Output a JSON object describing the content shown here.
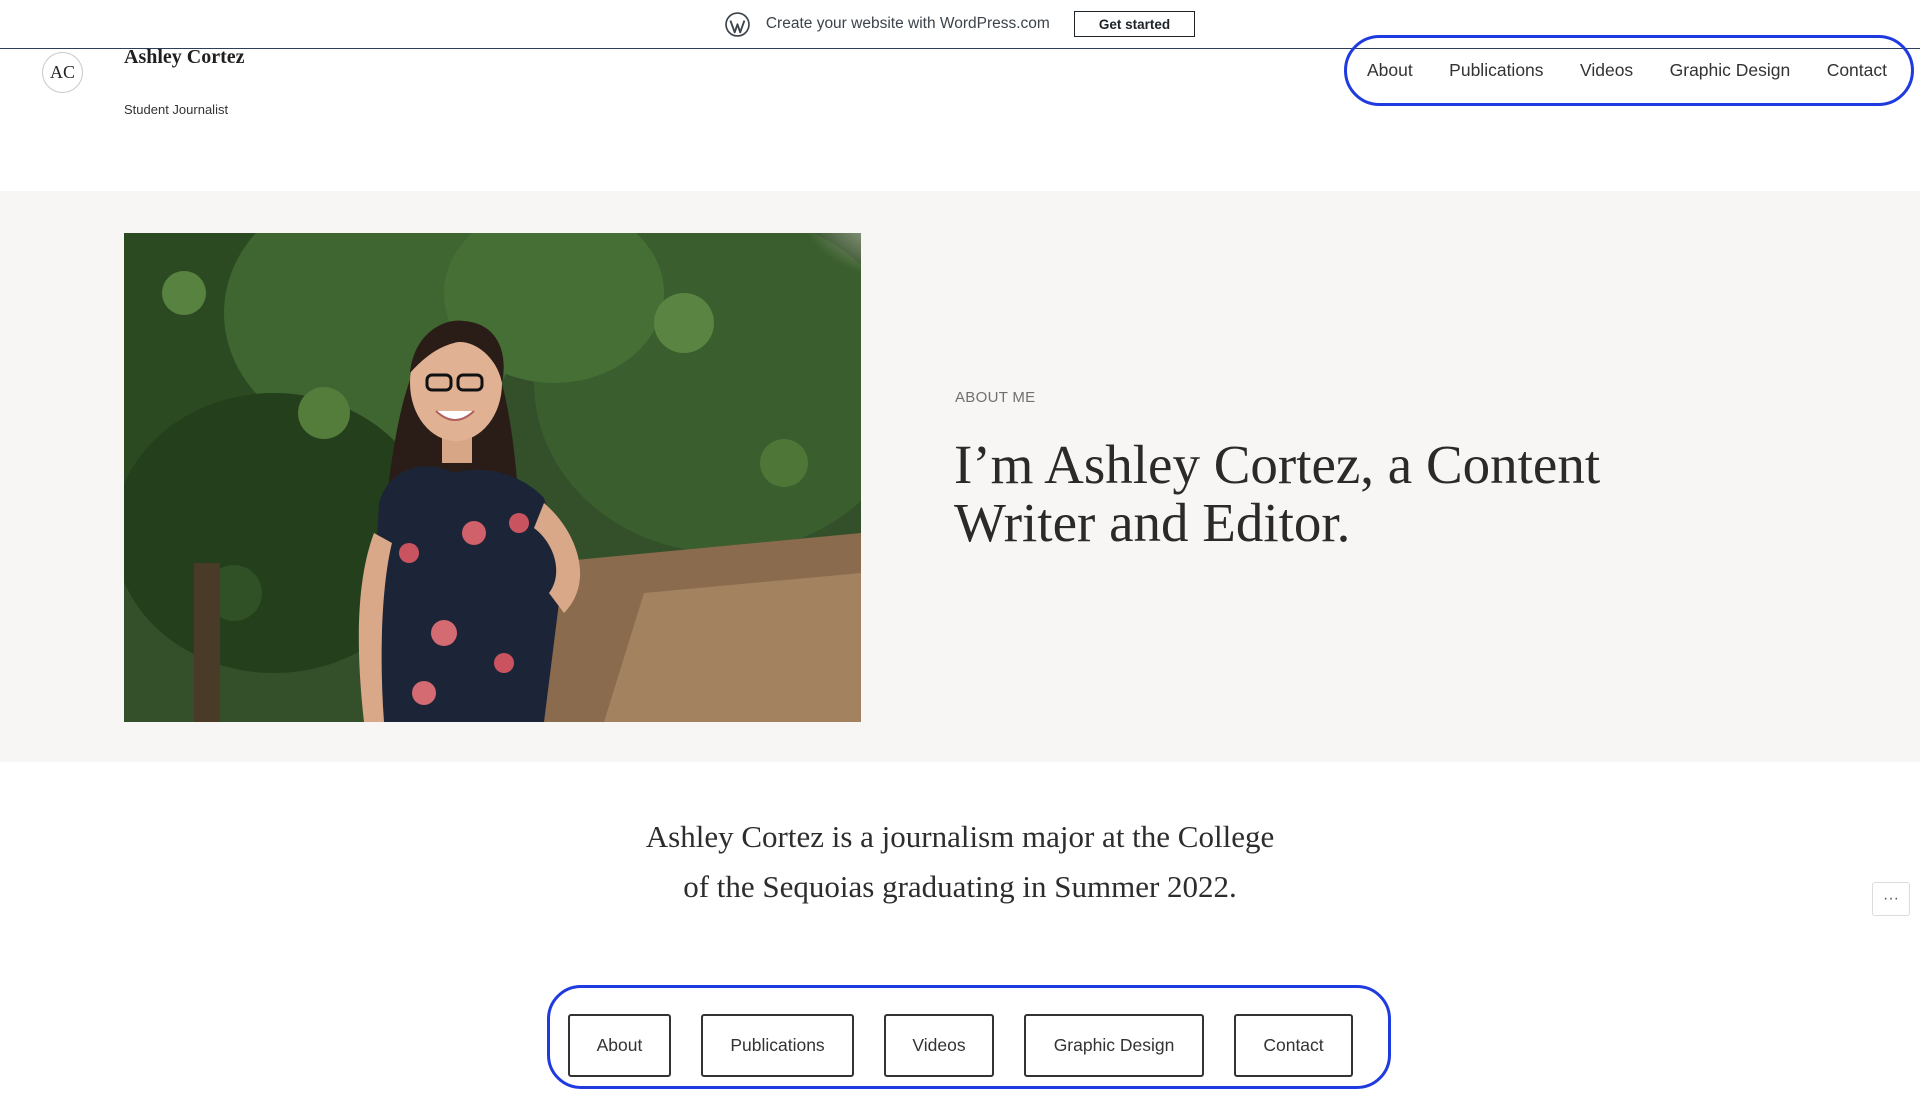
{
  "wp_bar": {
    "text": "Create your website with WordPress.com",
    "cta": "Get started",
    "icon": "wordpress-logo-icon"
  },
  "header": {
    "logo_initials": "AC",
    "title": "Ashley Cortez",
    "tagline": "Student Journalist",
    "nav": [
      "About",
      "Publications",
      "Videos",
      "Graphic Design",
      "Contact"
    ]
  },
  "hero": {
    "label": "ABOUT ME",
    "heading": "I’m Ashley Cortez, a Content Writer and Editor.",
    "image": "portrait-photo"
  },
  "bio": {
    "text": "Ashley Cortez is a journalism major at the College of the Sequoias graduating in Summer 2022."
  },
  "more_button": "ellipsis-icon",
  "bottom_nav": [
    "About",
    "Publications",
    "Videos",
    "Graphic Design",
    "Contact"
  ],
  "colors": {
    "highlight": "#1f3be0",
    "hero_background": "#f8f6f4"
  }
}
